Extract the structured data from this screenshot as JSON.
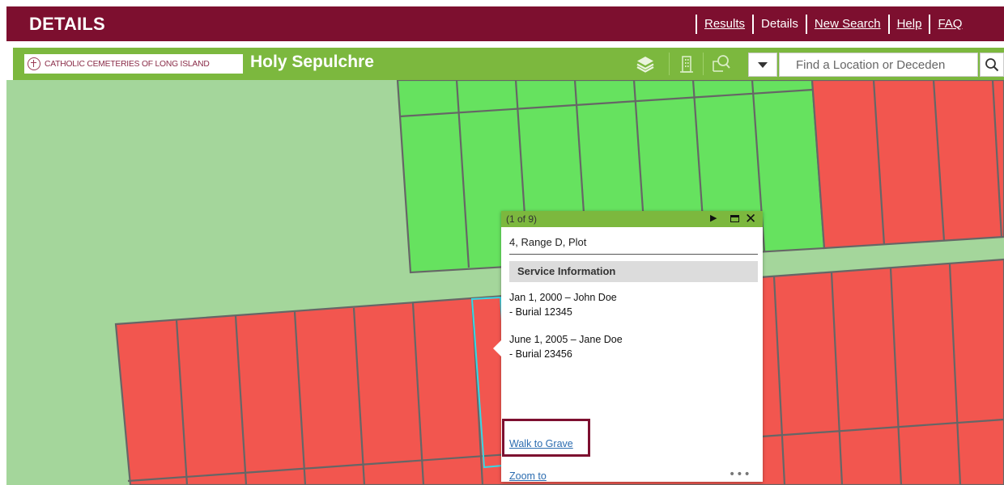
{
  "header": {
    "title": "DETAILS",
    "nav": {
      "results": "Results",
      "details": "Details",
      "new_search": "New Search",
      "help": "Help",
      "faq": "FAQ"
    }
  },
  "toolbar": {
    "logo_text": "CATHOLIC CEMETERIES OF LONG ISLAND",
    "site_name": "Holy Sepulchre",
    "icons": [
      "layers-icon",
      "building-icon",
      "search-location-icon"
    ],
    "search": {
      "placeholder": "Find a Location or Deceden",
      "value": ""
    }
  },
  "map": {
    "colors": {
      "background": "#a4d69b",
      "available_plot": "#66e25f",
      "occupied_plot": "#f2564f",
      "grid_line": "#666666",
      "selected_outline": "#36d8e6"
    }
  },
  "popup": {
    "count": "(1 of 9)",
    "title": "4, Range D, Plot",
    "section_title": "Service Information",
    "entries": [
      {
        "line1": "Jan 1, 2000 – John Doe",
        "line2": "- Burial 12345"
      },
      {
        "line1": "June 1, 2005 – Jane Doe",
        "line2": "- Burial 23456"
      }
    ],
    "walk_link": "Walk to Grave",
    "zoom_link": "Zoom to",
    "more": "•••"
  },
  "colors": {
    "header_bg": "#7d0f2f",
    "toolbar_bg": "#7cb83e",
    "link": "#2b6cb0"
  }
}
